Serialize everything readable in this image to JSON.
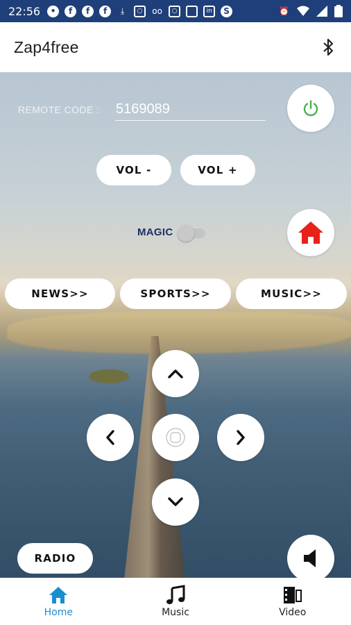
{
  "status_bar": {
    "time": "22:56",
    "left_icons": [
      "chat-icon",
      "facebook-icon",
      "facebook-icon",
      "facebook-icon",
      "download-icon",
      "instagram-icon",
      "voicemail-icon",
      "instagram-icon",
      "note-icon",
      "linkedin-icon",
      "shazam-icon"
    ],
    "right_icons": [
      "alarm-icon",
      "wifi-icon",
      "signal-icon",
      "battery-icon"
    ]
  },
  "app_bar": {
    "title": "Zap4free",
    "bluetooth_icon": "bluetooth-icon"
  },
  "remote": {
    "label": "REMOTE CODE :",
    "code_value": "5169089",
    "power_icon": "power-icon",
    "power_color": "#4caf50"
  },
  "volume": {
    "down_label": "VOL -",
    "up_label": "VOL +"
  },
  "magic": {
    "label": "MAGIC",
    "enabled": false
  },
  "home_button": {
    "icon": "home-icon",
    "color": "#e8211b"
  },
  "categories": [
    {
      "label": "NEWS>>"
    },
    {
      "label": "SPORTS>>"
    },
    {
      "label": "MUSIC>>"
    }
  ],
  "dpad": {
    "up_icon": "chevron-up-icon",
    "down_icon": "chevron-down-icon",
    "left_icon": "chevron-left-icon",
    "right_icon": "chevron-right-icon",
    "ok_icon": "ok-icon"
  },
  "radio_button": {
    "label": "RADIO"
  },
  "mute_button": {
    "icon": "speaker-icon"
  },
  "bottom_nav": {
    "items": [
      {
        "label": "Home",
        "icon": "home-icon",
        "active": true
      },
      {
        "label": "Music",
        "icon": "music-note-icon",
        "active": false
      },
      {
        "label": "Video",
        "icon": "video-icon",
        "active": false
      }
    ],
    "active_color": "#1a8fd0"
  }
}
